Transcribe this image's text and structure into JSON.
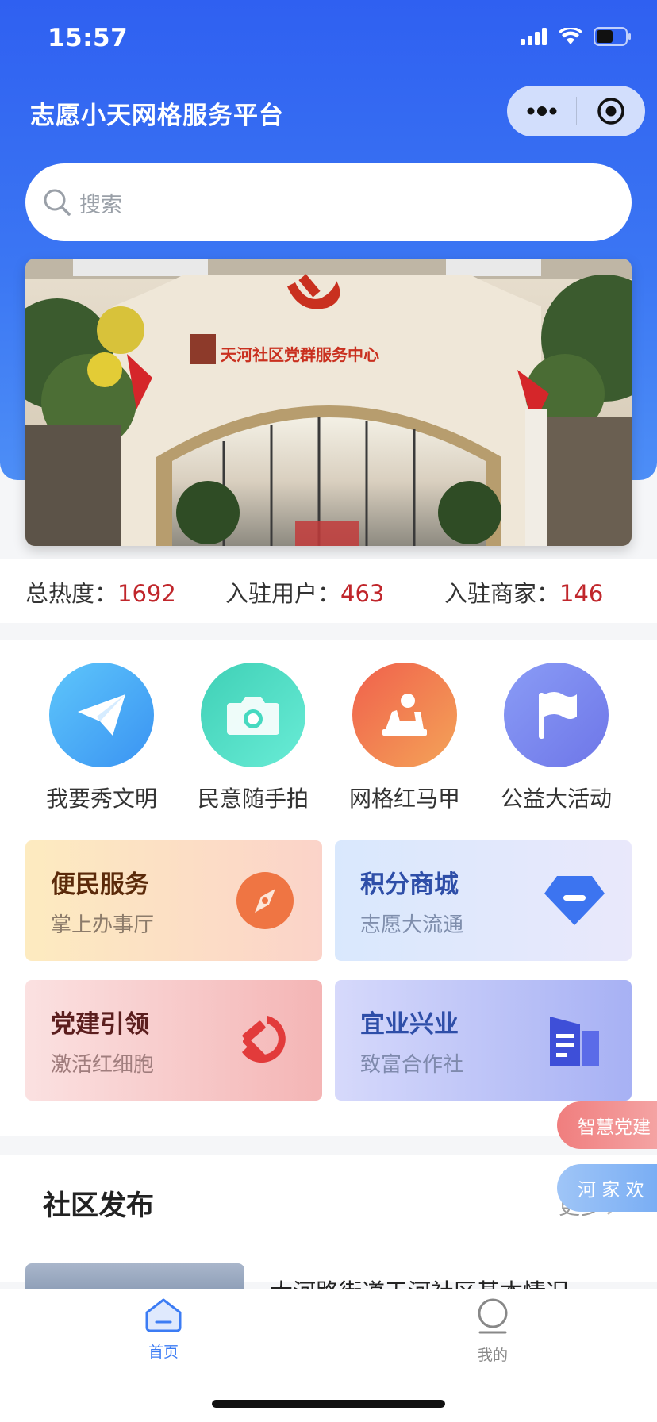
{
  "status_bar": {
    "time": "15:57"
  },
  "header": {
    "title": "志愿小天网格服务平台"
  },
  "search": {
    "placeholder": "搜索"
  },
  "banner": {
    "sign_text": "天河社区党群服务中心"
  },
  "stats": [
    {
      "label": "总热度：",
      "value": "1692"
    },
    {
      "label": "入驻用户：",
      "value": "463"
    },
    {
      "label": "入驻商家：",
      "value": "146"
    }
  ],
  "shortcuts": [
    {
      "label": "我要秀文明",
      "icon": "paper-plane-icon",
      "color": "#4aa8f7"
    },
    {
      "label": "民意随手拍",
      "icon": "camera-icon",
      "color": "#46d9c0"
    },
    {
      "label": "网格红马甲",
      "icon": "volunteer-icon",
      "color": "#ef7a4e"
    },
    {
      "label": "公益大活动",
      "icon": "flag-icon",
      "color": "#7c86ee"
    }
  ],
  "cards": [
    {
      "title": "便民服务",
      "subtitle": "掌上办事厅",
      "icon": "compass-icon"
    },
    {
      "title": "积分商城",
      "subtitle": "志愿大流通",
      "icon": "diamond-icon"
    },
    {
      "title": "党建引领",
      "subtitle": "激活红细胞",
      "icon": "hammer-sickle-icon"
    },
    {
      "title": "宜业兴业",
      "subtitle": "致富合作社",
      "icon": "building-icon"
    }
  ],
  "floating": {
    "party": "智慧党建",
    "welcome": "河 家 欢"
  },
  "community": {
    "title": "社区发布",
    "more": "更多",
    "news_title": "大河路街道天河社区基本情况"
  },
  "tabbar": [
    {
      "label": "首页",
      "icon": "home-icon",
      "active": true
    },
    {
      "label": "我的",
      "icon": "profile-icon",
      "active": false
    }
  ],
  "colors": {
    "primary": "#2f60f1",
    "accent_red": "#c0262b",
    "tab_active": "#3c7cf4"
  }
}
